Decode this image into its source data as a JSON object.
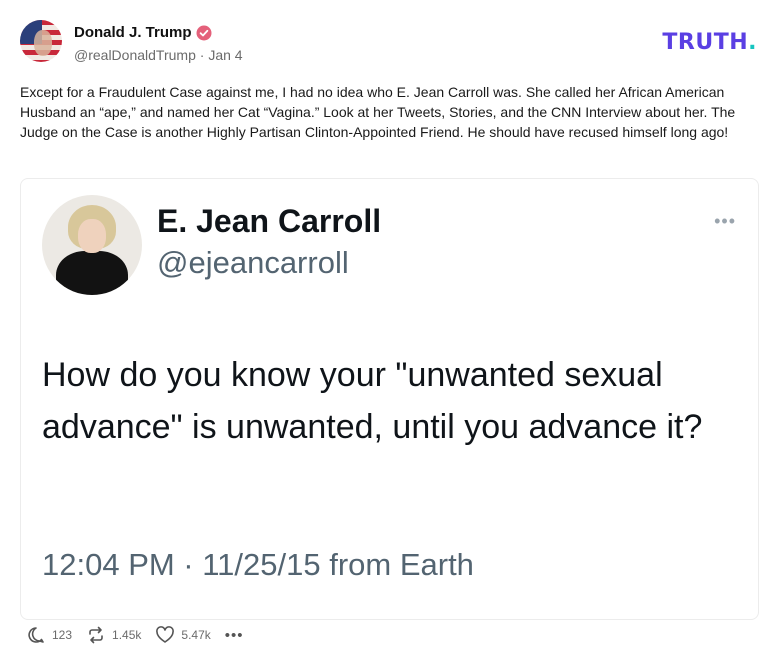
{
  "post": {
    "author_name": "Donald J. Trump",
    "handle": "@realDonaldTrump",
    "separator": "·",
    "date": "Jan 4",
    "text": "Except for a Fraudulent Case against me, I had no idea who E. Jean Carroll was. She called her African American Husband an “ape,” and named her Cat “Vagina.” Look at her Tweets, Stories, and the CNN Interview about her. The Judge on the Case is another Highly Partisan Clinton-Appointed Friend. He should have recused himself long ago!"
  },
  "brand": {
    "logo_text": "TRUTH",
    "logo_dot": ".",
    "accent": "#5a3fe3",
    "dot_color": "#16c5c0"
  },
  "embed": {
    "name": "E. Jean Carroll",
    "handle": "@ejeancarroll",
    "more": "•••",
    "text": "How do you know your \"unwanted sexual advance\" is unwanted, until you advance it?",
    "timestamp": "12:04 PM · 11/25/15 from Earth"
  },
  "actions": {
    "replies": "123",
    "retruths": "1.45k",
    "likes": "5.47k",
    "more": "•••"
  },
  "icons": [
    "verified-badge-icon",
    "reply-icon",
    "retruth-icon",
    "like-icon",
    "more-icon"
  ]
}
